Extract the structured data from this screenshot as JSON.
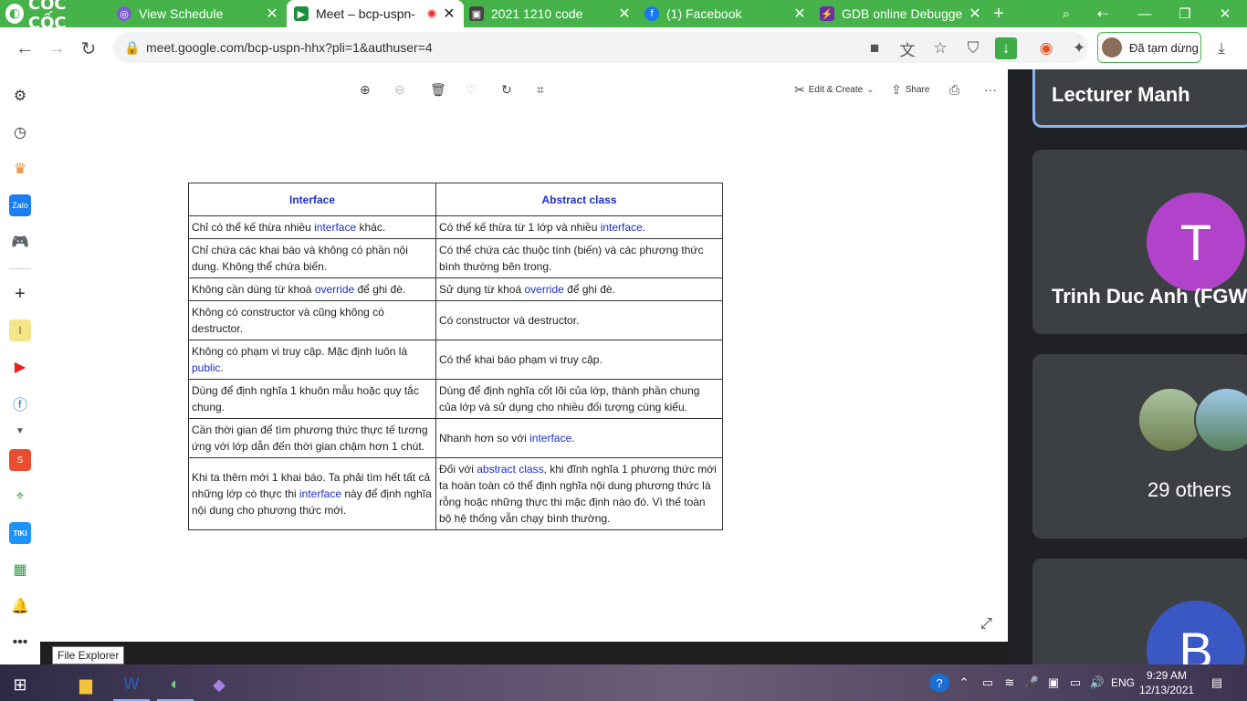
{
  "browser": {
    "brand": "CỐC CỐC",
    "tabs": [
      {
        "title": "View Schedule",
        "icon": "schedule-icon",
        "color": "#7a5ccf"
      },
      {
        "title": "Meet – bcp-uspn-",
        "icon": "meet-icon",
        "color": "#1e8e3e",
        "active": true,
        "recording": true
      },
      {
        "title": "2021 1210 code",
        "icon": "classroom-icon",
        "color": "#444444"
      },
      {
        "title": "(1) Facebook",
        "icon": "facebook-icon",
        "color": "#1877f2"
      },
      {
        "title": "GDB online Debugge",
        "icon": "gdb-icon",
        "color": "#6b2fa3"
      }
    ],
    "new_tab": "+",
    "url": "meet.google.com/bcp-uspn-hhx?pli=1&authuser=4",
    "profile_label": "Đã tạm dừng"
  },
  "viewer": {
    "tools": [
      {
        "name": "zoom-in-icon",
        "glyph": "⊕"
      },
      {
        "name": "zoom-out-icon",
        "glyph": "⊖",
        "disabled": true
      },
      {
        "name": "delete-icon",
        "glyph": "🗑"
      },
      {
        "name": "favorite-icon",
        "glyph": "♡",
        "disabled": true
      },
      {
        "name": "rotate-icon",
        "glyph": "↻"
      },
      {
        "name": "crop-icon",
        "glyph": "⌗"
      }
    ],
    "edit_create": "Edit & Create",
    "share": "Share",
    "print_glyph": "⎙",
    "more": "···"
  },
  "table": {
    "headers": [
      "Interface",
      "Abstract class"
    ],
    "rows": [
      {
        "a": [
          {
            "t": "Chỉ có thể kế thừa nhiều "
          },
          {
            "t": "interface",
            "kw": true
          },
          {
            "t": " khác."
          }
        ],
        "b": [
          {
            "t": "Có thể kế thừa từ 1 lớp và nhiều "
          },
          {
            "t": "interface.",
            "kw": true
          }
        ]
      },
      {
        "a": [
          {
            "t": "Chỉ chứa các khai báo và không có phần nội dung. Không thể chứa biến."
          }
        ],
        "b": [
          {
            "t": "Có thể chứa các thuộc tính (biến) và các phương thức bình thường bên trong."
          }
        ]
      },
      {
        "a": [
          {
            "t": "Không cần dùng từ khoá "
          },
          {
            "t": "override",
            "kw": true
          },
          {
            "t": " để ghi đè."
          }
        ],
        "b": [
          {
            "t": "Sử dụng từ khoá "
          },
          {
            "t": "override",
            "kw": true
          },
          {
            "t": " để ghi đè."
          }
        ]
      },
      {
        "a": [
          {
            "t": "Không có constructor và cũng không có destructor."
          }
        ],
        "b": [
          {
            "t": "Có constructor và destructor."
          }
        ]
      },
      {
        "a": [
          {
            "t": "Không có phạm vi truy cập. Mặc định luôn là "
          },
          {
            "t": "public",
            "kw": true
          },
          {
            "t": "."
          }
        ],
        "b": [
          {
            "t": "Có thể khai báo phạm vi truy cập."
          }
        ]
      },
      {
        "a": [
          {
            "t": "Dùng để định nghĩa 1 khuôn mẫu hoặc quy tắc chung."
          }
        ],
        "b": [
          {
            "t": "Dùng để định nghĩa cốt lõi của lớp, thành phần chung của lớp và sử dụng cho nhiều đối tượng cùng kiểu."
          }
        ]
      },
      {
        "a": [
          {
            "t": "Cần thời gian để tìm phương thức thực tế tương ứng với lớp dẫn đến thời gian chậm hơn 1 chút."
          }
        ],
        "b": [
          {
            "t": "Nhanh hơn so với "
          },
          {
            "t": "interface",
            "kw": true
          },
          {
            "t": "."
          }
        ]
      },
      {
        "a": [
          {
            "t": "Khi ta thêm mới 1 khai báo. Ta phải tìm hết tất cả những lớp có thực thi "
          },
          {
            "t": "interface",
            "kw": true
          },
          {
            "t": " này để định nghĩa nội dung cho phương thức mới."
          }
        ],
        "b": [
          {
            "t": "Đối với "
          },
          {
            "t": "abstract class",
            "kw": true
          },
          {
            "t": ", khi đĩnh nghĩa 1 phương thức mới ta hoàn toàn có thể định nghĩa nội dung phương thức là rỗng hoặc những thực thi mặc định nào đó. Vì thế toàn bộ hệ thống vẫn chạy bình thường."
          }
        ]
      }
    ]
  },
  "meet": {
    "lecturer": "Lecturer Manh",
    "p2_initial": "T",
    "p2_name": "Trinh Duc Anh (FGW",
    "p2_color": "#b043c9",
    "others": "29 others",
    "p4_initial": "B",
    "p4_color": "#3b57c4"
  },
  "tooltip": "File Explorer",
  "taskbar": {
    "lang": "ENG",
    "time": "9:29 AM",
    "date": "12/13/2021"
  }
}
